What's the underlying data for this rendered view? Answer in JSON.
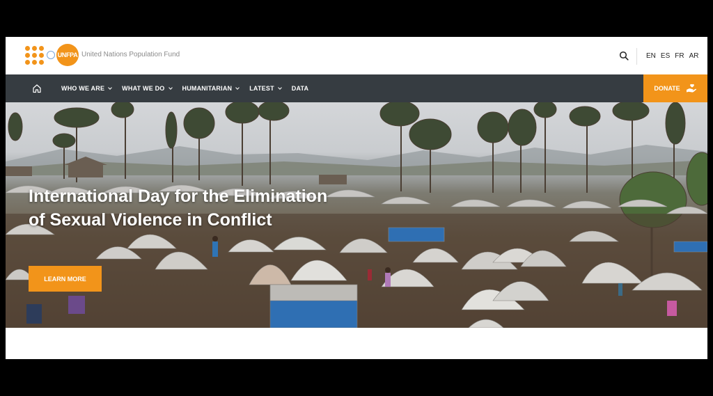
{
  "header": {
    "logo_text": "UNFPA",
    "org_name": "United Nations Population Fund",
    "search_icon": "search-icon",
    "languages": [
      "EN",
      "ES",
      "FR",
      "AR"
    ]
  },
  "nav": {
    "home_icon": "home-icon",
    "items": [
      {
        "label": "WHO WE ARE",
        "has_dropdown": true
      },
      {
        "label": "WHAT WE DO",
        "has_dropdown": true
      },
      {
        "label": "HUMANITARIAN",
        "has_dropdown": true
      },
      {
        "label": "LATEST",
        "has_dropdown": true
      },
      {
        "label": "DATA",
        "has_dropdown": false
      }
    ],
    "donate_label": "DONATE",
    "donate_icon": "hand-heart-icon"
  },
  "hero": {
    "title": "International Day for the Elimination of Sexual Violence in Conflict",
    "cta_label": "LEARN MORE"
  },
  "colors": {
    "accent": "#f2941a",
    "nav_bg": "#363c41",
    "text_dark": "#222222",
    "text_muted": "#8a8a8a"
  }
}
